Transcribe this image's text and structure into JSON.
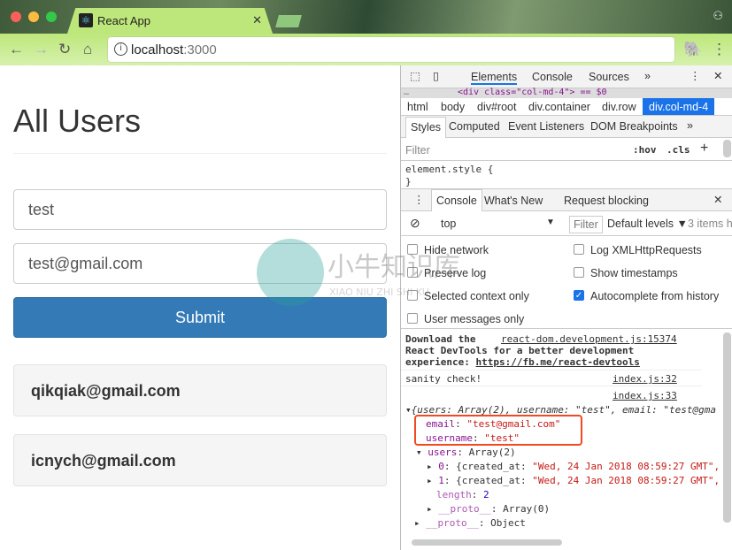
{
  "browser": {
    "tab_title": "React App",
    "url_host": "localhost",
    "url_port": ":3000",
    "colors": {
      "toolbar": "#bde77b"
    }
  },
  "page": {
    "title": "All Users",
    "username_value": "test",
    "email_value": "test@gmail.com",
    "submit_label": "Submit",
    "users": [
      "qikqiak@gmail.com",
      "icnych@gmail.com"
    ],
    "colors": {
      "primary": "#337ab7"
    }
  },
  "devtools": {
    "tabs": [
      "Elements",
      "Console",
      "Sources"
    ],
    "selected_node": "<div class=\"col-md-4\"> == $0",
    "breadcrumbs": [
      "html",
      "body",
      "div#root",
      "div.container",
      "div.row",
      "div.col-md-4"
    ],
    "style_tabs": [
      "Styles",
      "Computed",
      "Event Listeners",
      "DOM Breakpoints"
    ],
    "filter_placeholder": "Filter",
    "hov": ":hov",
    "cls": ".cls",
    "element_style": "element.style {",
    "close_brace": "}",
    "drawer_tabs": [
      "Console",
      "What's New",
      "Request blocking"
    ],
    "context": "top",
    "console_filter": "Filter",
    "levels": "Default levels ▼",
    "items_hidden": "3 items h",
    "settings": [
      {
        "label": "Hide network",
        "checked": false
      },
      {
        "label": "Log XMLHttpRequests",
        "checked": false
      },
      {
        "label": "Preserve log",
        "checked": false
      },
      {
        "label": "Show timestamps",
        "checked": false
      },
      {
        "label": "Selected context only",
        "checked": false
      },
      {
        "label": "Autocomplete from history",
        "checked": true
      },
      {
        "label": "User messages only",
        "checked": false
      }
    ],
    "console": {
      "msg1": {
        "text1": "Download the",
        "text2": "React DevTools for a better development",
        "text3": "experience: ",
        "link": "https://fb.me/react-devtools",
        "source": "react-dom.development.js:15374"
      },
      "msg2": {
        "text": "sanity check!",
        "source": "index.js:32"
      },
      "msg3": {
        "source": "index.js:33",
        "summary": "{users: Array(2), username: \"test\", email: \"test@gma",
        "email_key": "email",
        "email_val": "\"test@gmail.com\"",
        "username_key": "username",
        "username_val": "\"test\"",
        "users_key": "users",
        "users_val": "Array(2)",
        "item0_key": "0",
        "item0_val": "{created_at: ",
        "item0_date": "\"Wed, 24 Jan 2018 08:59:27 GMT\",",
        "item1_key": "1",
        "item1_val": "{created_at: ",
        "item1_date": "\"Wed, 24 Jan 2018 08:59:27 GMT\",",
        "length_key": "length",
        "length_val": "2",
        "proto_key": "__proto__",
        "proto_arr": "Array(0)",
        "proto_obj": "Object"
      }
    }
  },
  "watermark": {
    "text": "小牛知识库",
    "subtext": "XIAO NIU ZHI SHI KU"
  }
}
